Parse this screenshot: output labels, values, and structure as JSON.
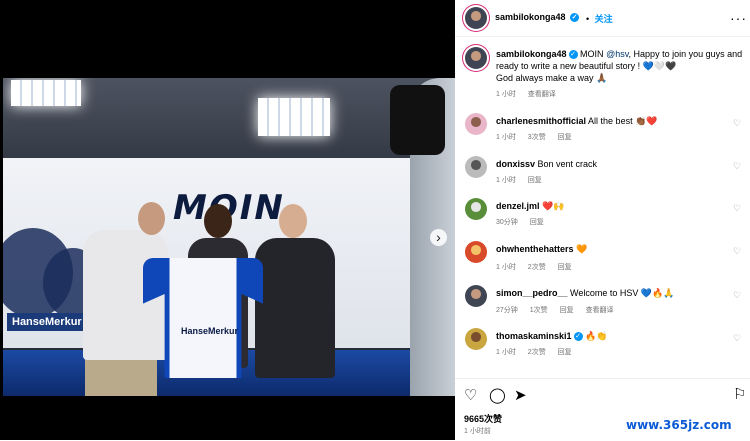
{
  "header": {
    "username": "sambilokonga48",
    "follow_label": "关注",
    "more_icon": "more-horizontal-icon"
  },
  "caption": {
    "username": "sambilokonga48",
    "lead": "MOIN",
    "mention": "@hsv",
    "text": ", Happy to join you guys and ready to write a new beautiful story ! 💙🤍🖤",
    "line2": "God always make a way 🙏🏾",
    "time": "1 小时",
    "translate": "查看翻译"
  },
  "comments": [
    {
      "username": "charlenesmithofficial",
      "text": "All the best 👏🏾❤️",
      "time": "1 小时",
      "likes": "3次赞",
      "reply": "回复"
    },
    {
      "username": "donxissv",
      "text": "Bon vent crack",
      "time": "1 小时",
      "likes": "",
      "reply": "回复"
    },
    {
      "username": "denzel.jml",
      "text": "❤️🙌",
      "time": "30分钟",
      "likes": "",
      "reply": "回复"
    },
    {
      "username": "ohwhenthehatters",
      "text": "🧡",
      "time": "1 小时",
      "likes": "2次赞",
      "reply": "回复"
    },
    {
      "username": "simon__pedro__",
      "text": "Welcome to HSV 💙🔥🙏",
      "time": "27分钟",
      "likes": "1次赞",
      "reply": "回复",
      "translate": "查看翻译"
    },
    {
      "username": "thomaskaminski1",
      "text": "🔥👏",
      "time": "1 小时",
      "likes": "2次赞",
      "reply": "回复"
    }
  ],
  "actions": {
    "likes": "9665次赞",
    "time": "1 小时前"
  },
  "photo": {
    "backdrop_word": "MOIN",
    "sponsor": "HanseMerkur",
    "jersey_sponsor": "HanseMerkur"
  },
  "watermark": "www.365jz.com",
  "colors": {
    "accent": "#0095f6",
    "mention": "#00376b",
    "meta": "#737373"
  }
}
